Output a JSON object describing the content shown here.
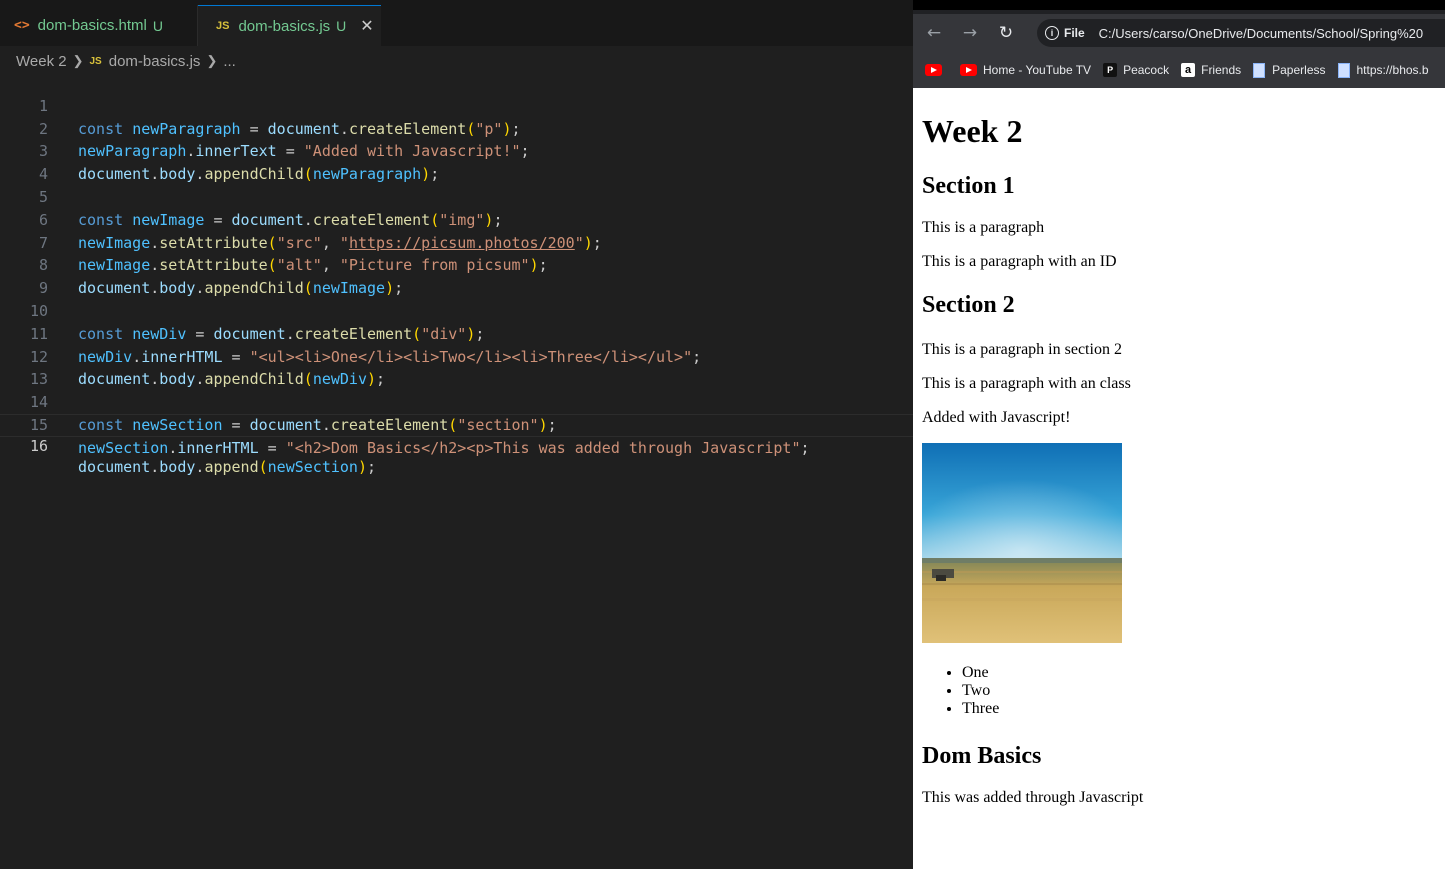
{
  "editor": {
    "tabs": [
      {
        "icon": "<>",
        "name": "dom-basics.html",
        "status": "U"
      },
      {
        "icon": "JS",
        "name": "dom-basics.js",
        "status": "U",
        "close": "✕"
      }
    ],
    "breadcrumb": {
      "folder": "Week 2",
      "file_icon": "JS",
      "file": "dom-basics.js",
      "more": "..."
    },
    "line_numbers": [
      "1",
      "2",
      "3",
      "4",
      "5",
      "6",
      "7",
      "8",
      "9",
      "10",
      "11",
      "12",
      "13",
      "14",
      "15",
      "16"
    ],
    "code": {
      "l1": {
        "kw": "const",
        "var": "newParagraph",
        "eq": " = ",
        "obj": "document",
        "dot": ".",
        "fn": "createElement",
        "open": "(",
        "str": "\"p\"",
        "close": ")",
        "end": ";"
      },
      "l2": {
        "var": "newParagraph",
        "dot": ".",
        "prop": "innerText",
        "eq": " = ",
        "str": "\"Added with Javascript!\"",
        "end": ";"
      },
      "l3": {
        "obj": "document",
        "dot": ".",
        "prop": "body",
        "dot2": ".",
        "fn": "appendChild",
        "open": "(",
        "arg": "newParagraph",
        "close": ")",
        "end": ";"
      },
      "l5": {
        "kw": "const",
        "var": "newImage",
        "eq": " = ",
        "obj": "document",
        "dot": ".",
        "fn": "createElement",
        "open": "(",
        "str": "\"img\"",
        "close": ")",
        "end": ";"
      },
      "l6": {
        "var": "newImage",
        "dot": ".",
        "fn": "setAttribute",
        "open": "(",
        "str1": "\"src\"",
        "comma": ", ",
        "q1": "\"",
        "url": "https://picsum.photos/200",
        "q2": "\"",
        "close": ")",
        "end": ";"
      },
      "l7": {
        "var": "newImage",
        "dot": ".",
        "fn": "setAttribute",
        "open": "(",
        "str1": "\"alt\"",
        "comma": ", ",
        "str2": "\"Picture from picsum\"",
        "close": ")",
        "end": ";"
      },
      "l8": {
        "obj": "document",
        "dot": ".",
        "prop": "body",
        "dot2": ".",
        "fn": "appendChild",
        "open": "(",
        "arg": "newImage",
        "close": ")",
        "end": ";"
      },
      "l10": {
        "kw": "const",
        "var": "newDiv",
        "eq": " = ",
        "obj": "document",
        "dot": ".",
        "fn": "createElement",
        "open": "(",
        "str": "\"div\"",
        "close": ")",
        "end": ";"
      },
      "l11": {
        "var": "newDiv",
        "dot": ".",
        "prop": "innerHTML",
        "eq": " = ",
        "str": "\"<ul><li>One</li><li>Two</li><li>Three</li></ul>\"",
        "end": ";"
      },
      "l12": {
        "obj": "document",
        "dot": ".",
        "prop": "body",
        "dot2": ".",
        "fn": "appendChild",
        "open": "(",
        "arg": "newDiv",
        "close": ")",
        "end": ";"
      },
      "l14": {
        "kw": "const",
        "var": "newSection",
        "eq": " = ",
        "obj": "document",
        "dot": ".",
        "fn": "createElement",
        "open": "(",
        "str": "\"section\"",
        "close": ")",
        "end": ";"
      },
      "l15": {
        "var": "newSection",
        "dot": ".",
        "prop": "innerHTML",
        "eq": " = ",
        "str": "\"<h2>Dom Basics</h2><p>This was added through Javascript\"",
        "end": ";"
      },
      "l16": {
        "obj": "document",
        "dot": ".",
        "prop": "body",
        "dot2": ".",
        "fn": "append",
        "open": "(",
        "arg": "newSection",
        "close": ")",
        "end": ";"
      }
    }
  },
  "browser": {
    "nav": {
      "back": "←",
      "forward": "→",
      "reload": "↻"
    },
    "address": {
      "chip_icon": "i",
      "chip": "File",
      "url": "C:/Users/carso/OneDrive/Documents/School/Spring%20"
    },
    "bookmarks": [
      {
        "icon": "youtube-icon",
        "label": ""
      },
      {
        "icon": "youtube-icon",
        "label": "Home - YouTube TV"
      },
      {
        "icon": "peacock-icon",
        "glyph": "P",
        "label": "Peacock"
      },
      {
        "icon": "amazon-icon",
        "glyph": "a",
        "label": "Friends"
      },
      {
        "icon": "page-icon",
        "label": "Paperless"
      },
      {
        "icon": "page-icon",
        "label": "https://bhos.b"
      }
    ],
    "page": {
      "h1": "Week 2",
      "section1_heading": "Section 1",
      "p1": "This is a paragraph",
      "p2": "This is a paragraph with an ID",
      "section2_heading": "Section 2",
      "p3": "This is a paragraph in section 2",
      "p4": "This is a paragraph with an class",
      "p5": "Added with Javascript!",
      "image_alt": "Picture from picsum",
      "list": [
        "One",
        "Two",
        "Three"
      ],
      "dom_heading": "Dom Basics",
      "p6": "This was added through Javascript"
    }
  }
}
